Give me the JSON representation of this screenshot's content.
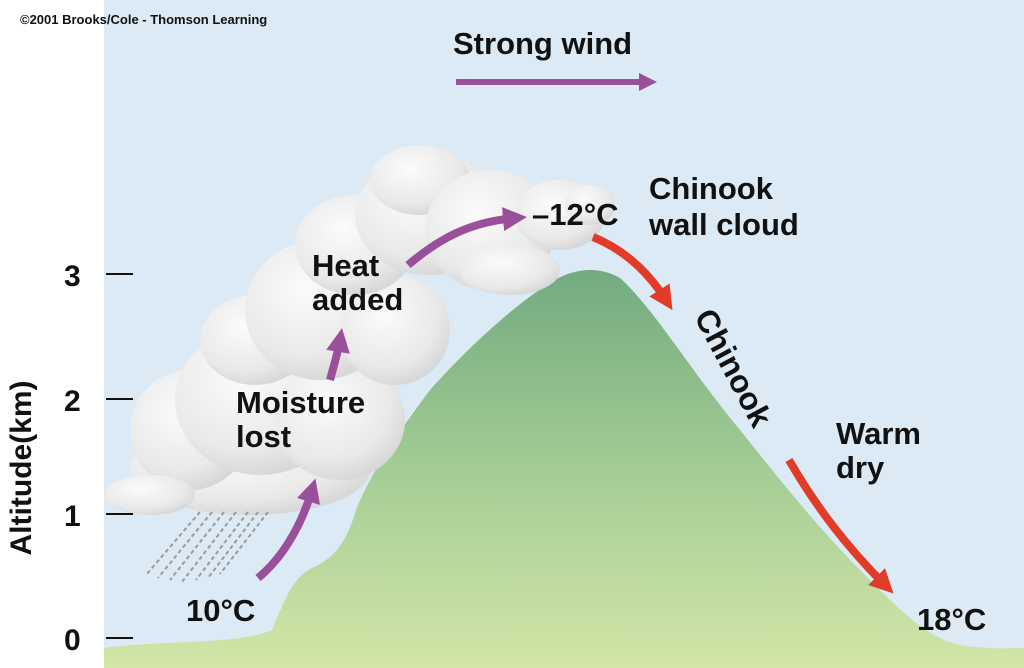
{
  "copyright": "©2001 Brooks/Cole - Thomson Learning",
  "wind_label": "Strong wind",
  "axis": {
    "title": "Altitude(km)",
    "ticks": [
      "3",
      "2",
      "1",
      "0"
    ]
  },
  "labels": {
    "temp_start": "10°C",
    "temp_top": "–12°C",
    "temp_end": "18°C",
    "moisture_lost": [
      "Moisture",
      "lost"
    ],
    "heat_added": [
      "Heat",
      "added"
    ],
    "wall_cloud": [
      "Chinook",
      "wall cloud"
    ],
    "chinook": "Chinook",
    "warm_dry": [
      "Warm",
      "dry"
    ]
  },
  "colors": {
    "sky": "#dbeaf4",
    "mountain_top": "#72ab80",
    "mountain_bottom": "#cde3a4",
    "cloud": "#ececec",
    "rising_arrow": "#9a4f9b",
    "descending_arrow": "#e03c28",
    "rain": "#9a9a9a"
  }
}
